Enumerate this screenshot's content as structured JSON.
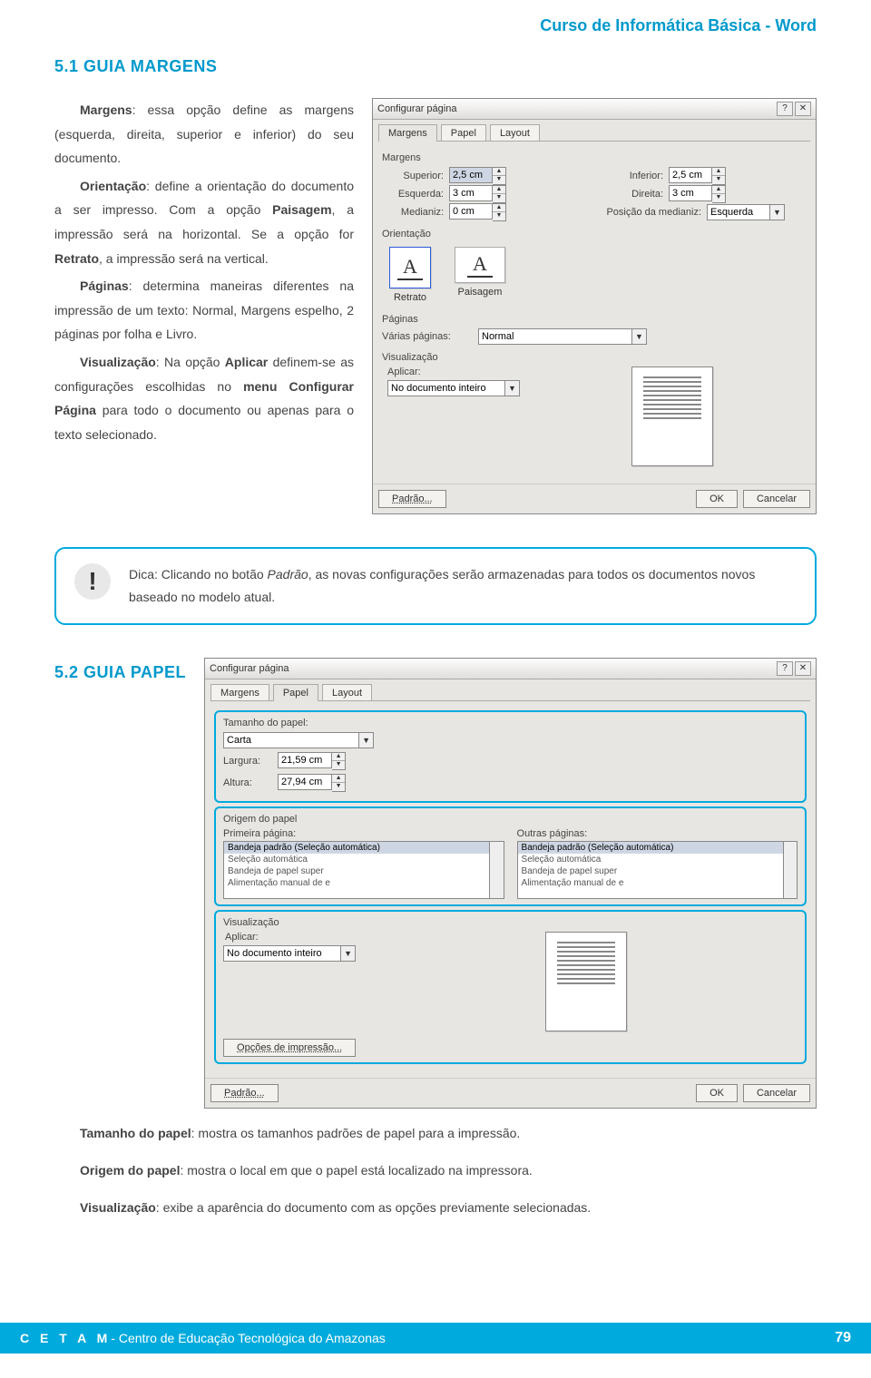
{
  "header": {
    "course_title": "Curso de Informática Básica - Word"
  },
  "section51": {
    "title": "5.1 GUIA MARGENS",
    "p1_bold": "Margens",
    "p1_rest": ": essa opção define as margens (esquerda, direita, superior e inferior) do seu documento.",
    "p2_bold": "Orientação",
    "p2_mid": ": define a orientação do documento a ser impresso. Com a opção ",
    "p2_bold2": "Paisagem",
    "p2_mid2": ", a impressão será na horizontal. Se a opção for ",
    "p2_bold3": "Retrato",
    "p2_end": ", a impressão será na vertical.",
    "p3_bold": "Páginas",
    "p3_rest": ": determina maneiras diferentes na impressão de um texto: Normal, Margens espelho, 2 páginas por folha e Livro.",
    "p4_bold": "Visualização",
    "p4_mid": ": Na opção ",
    "p4_bold2": "Aplicar",
    "p4_mid2": " definem-se as configurações escolhidas no ",
    "p4_bold3": "menu Configurar Página",
    "p4_end": " para todo o documento ou apenas para o texto selecionado."
  },
  "dialog1": {
    "title": "Configurar página",
    "tabs": {
      "margens": "Margens",
      "papel": "Papel",
      "layout": "Layout"
    },
    "margens_group": "Margens",
    "superior_lbl": "Superior:",
    "superior_val": "2,5 cm",
    "inferior_lbl": "Inferior:",
    "inferior_val": "2,5 cm",
    "esquerda_lbl": "Esquerda:",
    "esquerda_val": "3 cm",
    "direita_lbl": "Direita:",
    "direita_val": "3 cm",
    "medianiz_lbl": "Medianiz:",
    "medianiz_val": "0 cm",
    "posmed_lbl": "Posição da medianiz:",
    "posmed_val": "Esquerda",
    "orient_group": "Orientação",
    "retrato": "Retrato",
    "paisagem": "Paisagem",
    "paginas_group": "Páginas",
    "varias_lbl": "Várias páginas:",
    "varias_val": "Normal",
    "visual_group": "Visualização",
    "aplicar_lbl": "Aplicar:",
    "aplicar_val": "No documento inteiro",
    "padrao_btn": "Padrão...",
    "ok_btn": "OK",
    "cancel_btn": "Cancelar"
  },
  "tip": {
    "text_pre": "Dica: Clicando no botão ",
    "text_i": "Padrão",
    "text_post": ", as novas configurações serão armazenadas para todos os documentos novos baseado no modelo atual."
  },
  "section52": {
    "title": "5.2 GUIA PAPEL"
  },
  "dialog2": {
    "title": "Configurar página",
    "tabs": {
      "margens": "Margens",
      "papel": "Papel",
      "layout": "Layout"
    },
    "tamanho_group": "Tamanho do papel:",
    "papel_val": "Carta",
    "largura_lbl": "Largura:",
    "largura_val": "21,59 cm",
    "altura_lbl": "Altura:",
    "altura_val": "27,94 cm",
    "origem_group": "Origem do papel",
    "primeira_lbl": "Primeira página:",
    "outras_lbl": "Outras páginas:",
    "list_items": [
      "Bandeja padrão (Seleção automática)",
      "Seleção automática",
      "Bandeja de papel super",
      "Alimentação manual de e"
    ],
    "visual_group": "Visualização",
    "aplicar_lbl": "Aplicar:",
    "aplicar_val": "No documento inteiro",
    "print_opts": "Opções de impressão...",
    "padrao_btn": "Padrão...",
    "ok_btn": "OK",
    "cancel_btn": "Cancelar"
  },
  "below": {
    "l1_bold": "Tamanho do papel",
    "l1_rest": ": mostra os tamanhos padrões de papel para a impressão.",
    "l2_bold": "Origem do papel",
    "l2_rest": ": mostra o local em que o papel está localizado na impressora.",
    "l3_bold": "Visualização",
    "l3_rest": ": exibe a aparência do documento com as opções previamente selecionadas."
  },
  "footer": {
    "cetam": "C E T A M",
    "org": " - Centro de Educação Tecnológica do Amazonas",
    "page": "79"
  }
}
